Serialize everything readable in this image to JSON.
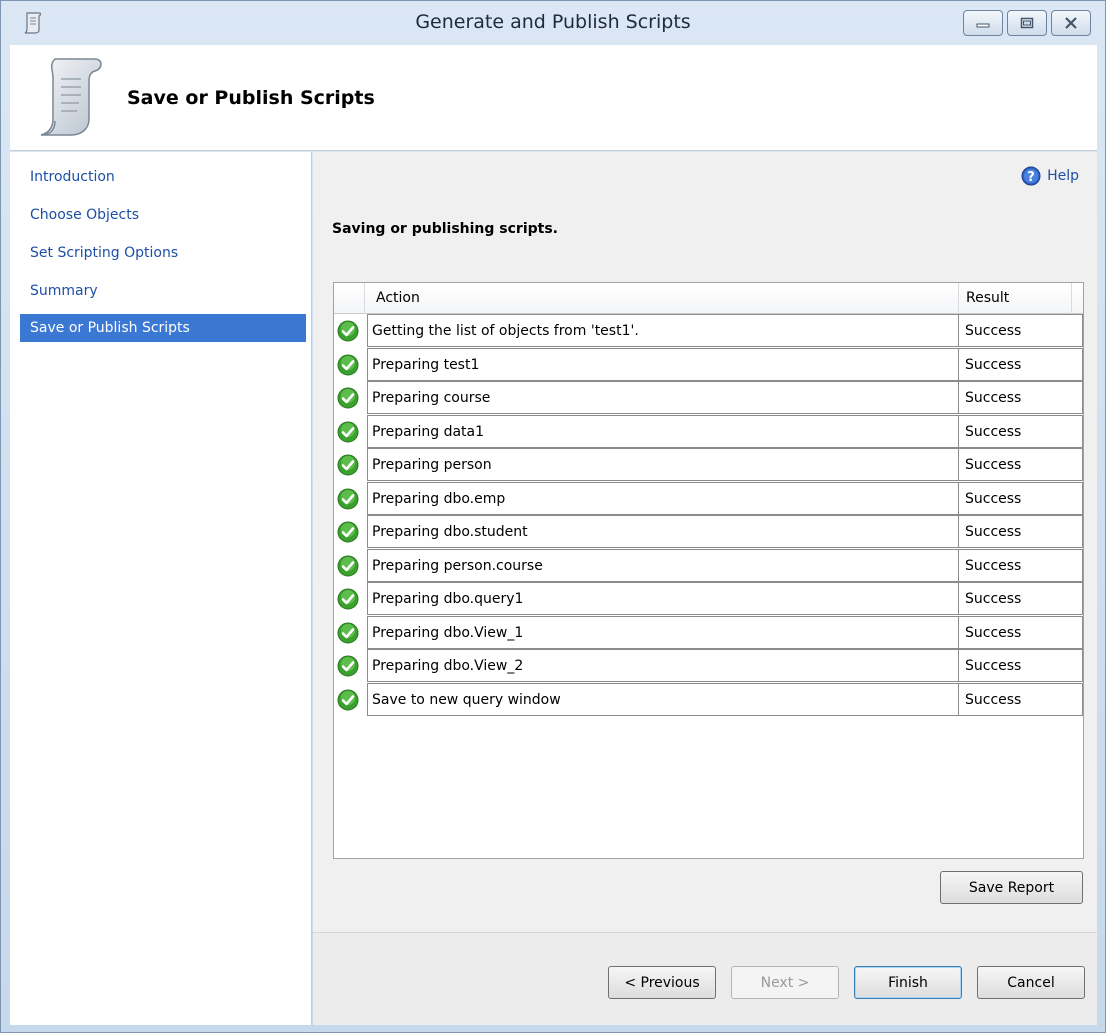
{
  "window": {
    "title": "Generate and Publish Scripts"
  },
  "header": {
    "title": "Save or Publish Scripts"
  },
  "sidebar": {
    "items": [
      {
        "label": "Introduction"
      },
      {
        "label": "Choose Objects"
      },
      {
        "label": "Set Scripting Options"
      },
      {
        "label": "Summary"
      },
      {
        "label": "Save or Publish Scripts",
        "active": true
      }
    ]
  },
  "content": {
    "help_label": "Help",
    "section_title": "Saving or publishing scripts.",
    "table": {
      "columns": [
        "Action",
        "Result"
      ],
      "rows": [
        {
          "action": "Getting the list of objects from 'test1'.",
          "result": "Success",
          "icon": "success-check-icon"
        },
        {
          "action": "Preparing test1",
          "result": "Success",
          "icon": "success-check-icon"
        },
        {
          "action": "Preparing course",
          "result": "Success",
          "icon": "success-check-icon"
        },
        {
          "action": "Preparing data1",
          "result": "Success",
          "icon": "success-check-icon"
        },
        {
          "action": "Preparing person",
          "result": "Success",
          "icon": "success-check-icon"
        },
        {
          "action": "Preparing dbo.emp",
          "result": "Success",
          "icon": "success-check-icon"
        },
        {
          "action": "Preparing dbo.student",
          "result": "Success",
          "icon": "success-check-icon"
        },
        {
          "action": "Preparing person.course",
          "result": "Success",
          "icon": "success-check-icon"
        },
        {
          "action": "Preparing dbo.query1",
          "result": "Success",
          "icon": "success-check-icon"
        },
        {
          "action": "Preparing dbo.View_1",
          "result": "Success",
          "icon": "success-check-icon"
        },
        {
          "action": "Preparing dbo.View_2",
          "result": "Success",
          "icon": "success-check-icon"
        },
        {
          "action": "Save to new query window",
          "result": "Success",
          "icon": "success-check-icon"
        }
      ]
    },
    "save_report_label": "Save Report"
  },
  "footer": {
    "previous_label": "< Previous",
    "next_label": "Next >",
    "finish_label": "Finish",
    "cancel_label": "Cancel"
  },
  "colors": {
    "accent": "#3b78d4",
    "link": "#1d4fa6",
    "success": "#3aa02e"
  }
}
